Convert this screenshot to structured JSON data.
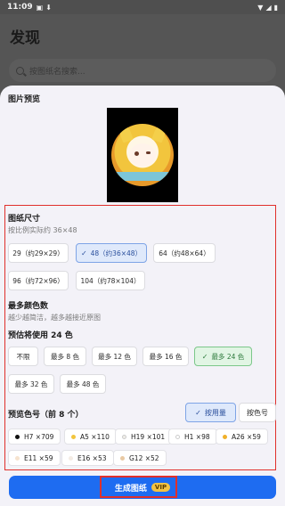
{
  "status_bar": {
    "time": "11:09"
  },
  "background": {
    "title": "发现",
    "search_placeholder": "按图纸名搜索..."
  },
  "sheet": {
    "preview_label": "图片预览",
    "size": {
      "label": "图纸尺寸",
      "hint": "按比例实际约 36×48",
      "options": [
        {
          "label": "29（约29×29）",
          "selected": false
        },
        {
          "label": "48（约36×48）",
          "selected": true
        },
        {
          "label": "64（约48×64）",
          "selected": false
        },
        {
          "label": "96（约72×96）",
          "selected": false
        },
        {
          "label": "104（约78×104）",
          "selected": false
        }
      ]
    },
    "colors": {
      "label": "最多颜色数",
      "hint": "越少越简洁，越多越接近原图",
      "estimate": "预估将使用 24 色",
      "options": [
        {
          "label": "不限",
          "selected": false
        },
        {
          "label": "最多 8 色",
          "selected": false
        },
        {
          "label": "最多 12 色",
          "selected": false
        },
        {
          "label": "最多 16 色",
          "selected": false
        },
        {
          "label": "最多 24 色",
          "selected": true
        },
        {
          "label": "最多 32 色",
          "selected": false
        },
        {
          "label": "最多 48 色",
          "selected": false
        }
      ]
    },
    "preview_colors": {
      "label": "预览色号（前 8 个）",
      "sort_by_usage": "按用量",
      "sort_by_code": "按色号",
      "items": [
        {
          "label": "H7 ×709",
          "color": "#111111"
        },
        {
          "label": "A5 ×110",
          "color": "#f2c53d"
        },
        {
          "label": "H19 ×101",
          "color": "#f0eee8"
        },
        {
          "label": "H1 ×98",
          "color": "#ffffff"
        },
        {
          "label": "A26 ×59",
          "color": "#f0b02a"
        },
        {
          "label": "E11 ×59",
          "color": "#f6e3cf"
        },
        {
          "label": "E16 ×53",
          "color": "#f4ece4"
        },
        {
          "label": "G12 ×52",
          "color": "#e9c9a3"
        }
      ]
    },
    "generate": {
      "label": "生成图纸",
      "badge": "VIP"
    }
  },
  "colors": {
    "accent": "#1e6cf1",
    "highlight": "#e0302c",
    "selected_green": "#2d7a3c"
  }
}
